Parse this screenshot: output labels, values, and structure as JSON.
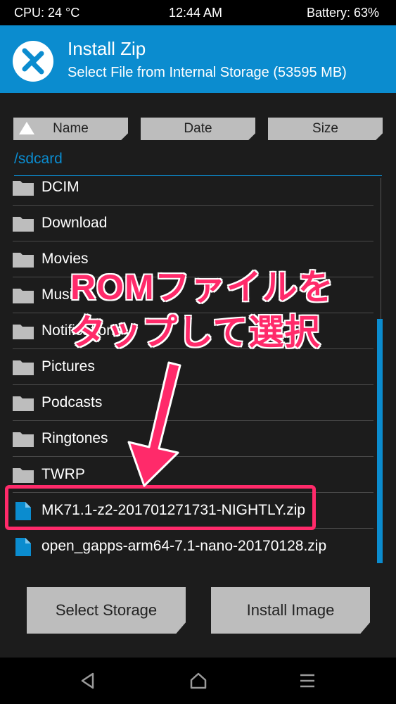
{
  "status": {
    "cpu": "CPU: 24 °C",
    "time": "12:44 AM",
    "battery": "Battery: 63%"
  },
  "header": {
    "title": "Install Zip",
    "subtitle": "Select File from Internal Storage (53595 MB)"
  },
  "sort": {
    "name": "Name",
    "date": "Date",
    "size": "Size"
  },
  "path": "/sdcard",
  "files": [
    {
      "label": "DCIM",
      "type": "folder"
    },
    {
      "label": "Download",
      "type": "folder"
    },
    {
      "label": "Movies",
      "type": "folder"
    },
    {
      "label": "Music",
      "type": "folder"
    },
    {
      "label": "Notifications",
      "type": "folder"
    },
    {
      "label": "Pictures",
      "type": "folder"
    },
    {
      "label": "Podcasts",
      "type": "folder"
    },
    {
      "label": "Ringtones",
      "type": "folder"
    },
    {
      "label": "TWRP",
      "type": "folder"
    },
    {
      "label": "MK71.1-z2-201701271731-NIGHTLY.zip",
      "type": "file"
    },
    {
      "label": "open_gapps-arm64-7.1-nano-20170128.zip",
      "type": "file"
    }
  ],
  "buttons": {
    "select_storage": "Select Storage",
    "install_image": "Install Image"
  },
  "annotation": {
    "line1": "ROMファイルを",
    "line2": "タップして選択"
  },
  "colors": {
    "accent": "#0b8ccf",
    "annotation": "#ff2a6a"
  }
}
